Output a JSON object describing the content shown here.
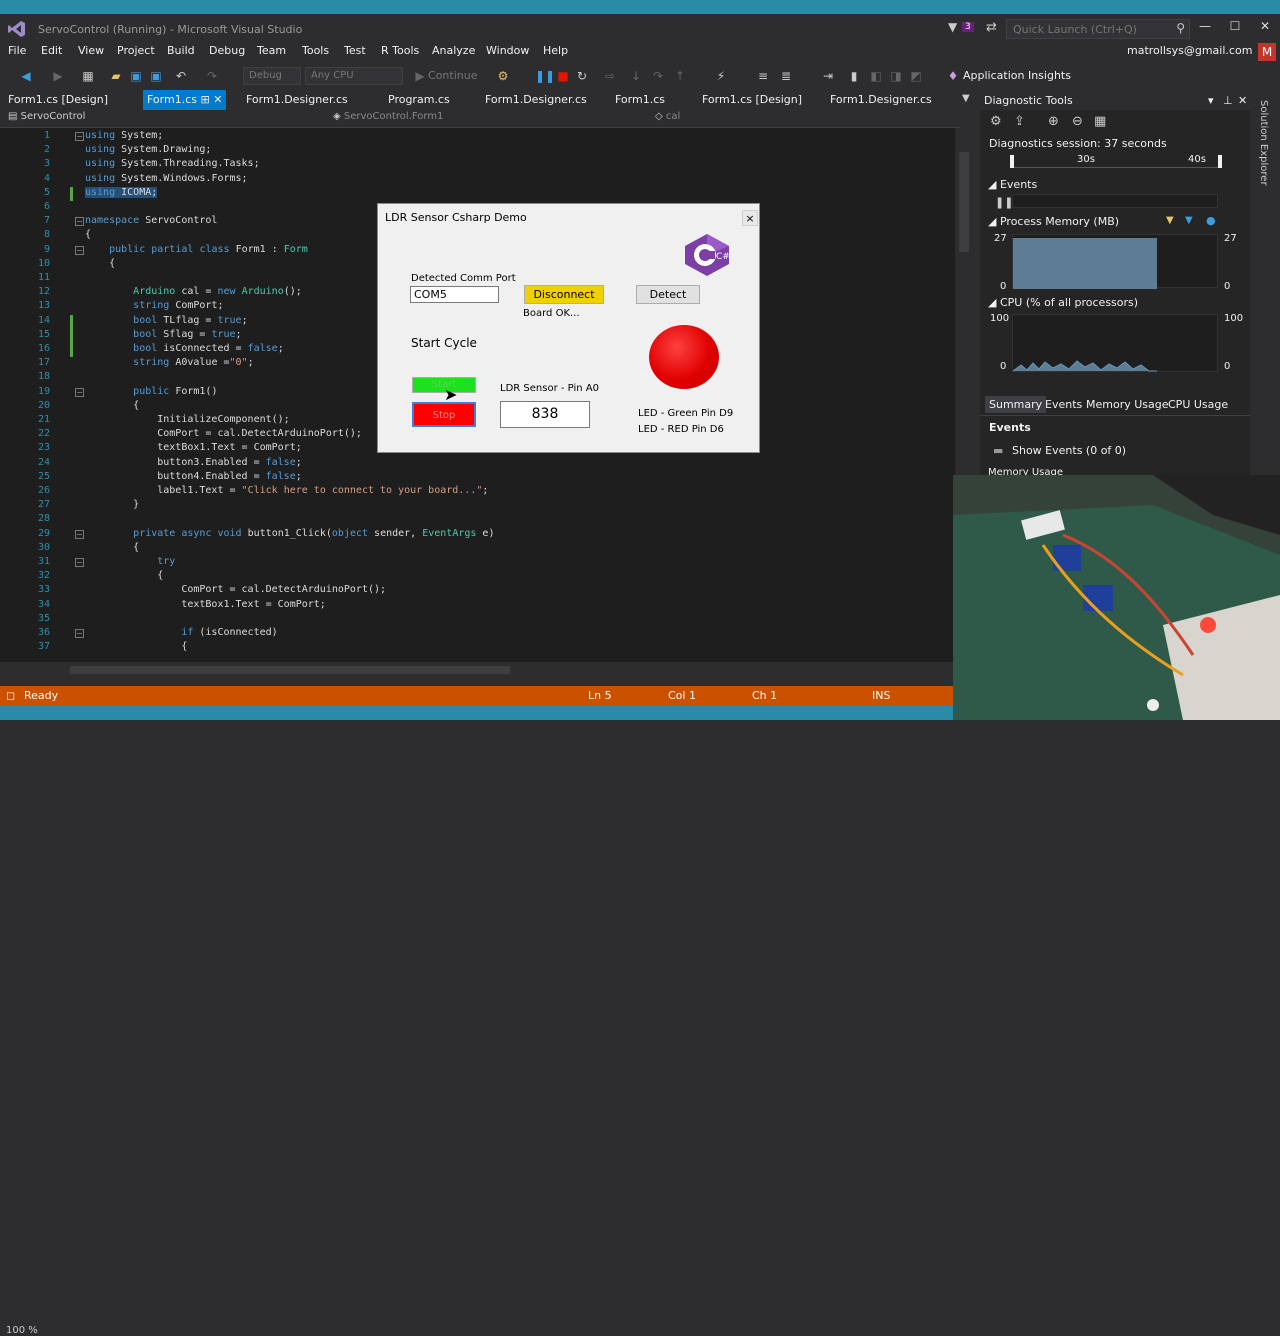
{
  "window": {
    "title": "ServoControl (Running) - Microsoft Visual Studio",
    "notifications": "3",
    "quick_launch_placeholder": "Quick Launch (Ctrl+Q)",
    "account": "matrollsys@gmail.com",
    "avatar_letter": "M"
  },
  "menu": [
    "File",
    "Edit",
    "View",
    "Project",
    "Build",
    "Debug",
    "Team",
    "Tools",
    "Test",
    "R Tools",
    "Analyze",
    "Window",
    "Help"
  ],
  "toolbar": {
    "config": "Debug",
    "platform": "Any CPU",
    "continue_label": "Continue",
    "insights_label": "Application Insights"
  },
  "tabs": [
    "Form1.cs [Design]",
    "Form1.cs",
    "Form1.Designer.cs",
    "Program.cs",
    "Form1.Designer.cs",
    "Form1.cs",
    "Form1.cs [Design]",
    "Form1.Designer.cs"
  ],
  "navbar": {
    "project": "ServoControl",
    "class": "ServoControl.Form1",
    "member": "cal"
  },
  "code_lines": [
    {
      "n": "1",
      "t": "using System;"
    },
    {
      "n": "2",
      "t": "using System.Drawing;"
    },
    {
      "n": "3",
      "t": "using System.Threading.Tasks;"
    },
    {
      "n": "4",
      "t": "using System.Windows.Forms;"
    },
    {
      "n": "5",
      "t": "using ICOMA;"
    },
    {
      "n": "6",
      "t": ""
    },
    {
      "n": "7",
      "t": "namespace ServoControl"
    },
    {
      "n": "8",
      "t": "{"
    },
    {
      "n": "9",
      "t": "    public partial class Form1 : Form"
    },
    {
      "n": "10",
      "t": "    {"
    },
    {
      "n": "11",
      "t": ""
    },
    {
      "n": "12",
      "t": "        Arduino cal = new Arduino();"
    },
    {
      "n": "13",
      "t": "        string ComPort;"
    },
    {
      "n": "14",
      "t": "        bool TLflag = true;"
    },
    {
      "n": "15",
      "t": "        bool Sflag = true;"
    },
    {
      "n": "16",
      "t": "        bool isConnected = false;"
    },
    {
      "n": "17",
      "t": "        string A0value =\"0\";"
    },
    {
      "n": "18",
      "t": ""
    },
    {
      "n": "19",
      "t": "        public Form1()"
    },
    {
      "n": "20",
      "t": "        {"
    },
    {
      "n": "21",
      "t": "            InitializeComponent();"
    },
    {
      "n": "22",
      "t": "            ComPort = cal.DetectArduinoPort();"
    },
    {
      "n": "23",
      "t": "            textBox1.Text = ComPort;"
    },
    {
      "n": "24",
      "t": "            button3.Enabled = false;"
    },
    {
      "n": "25",
      "t": "            button4.Enabled = false;"
    },
    {
      "n": "26",
      "t": "            label1.Text = \"Click here to connect to your board...\";"
    },
    {
      "n": "27",
      "t": "        }"
    },
    {
      "n": "28",
      "t": ""
    },
    {
      "n": "29",
      "t": "        private async void button1_Click(object sender, EventArgs e)"
    },
    {
      "n": "30",
      "t": "        {"
    },
    {
      "n": "31",
      "t": "            try"
    },
    {
      "n": "32",
      "t": "            {"
    },
    {
      "n": "33",
      "t": "                ComPort = cal.DetectArduinoPort();"
    },
    {
      "n": "34",
      "t": "                textBox1.Text = ComPort;"
    },
    {
      "n": "35",
      "t": ""
    },
    {
      "n": "36",
      "t": "                if (isConnected)"
    },
    {
      "n": "37",
      "t": "                {"
    }
  ],
  "zoom": "100 %",
  "status": {
    "state": "Ready",
    "line": "Ln 5",
    "col": "Col 1",
    "ch": "Ch 1",
    "mode": "INS"
  },
  "diagnostics": {
    "title": "Diagnostic Tools",
    "session": "Diagnostics session: 37 seconds",
    "timeline_30": "30s",
    "timeline_40": "40s",
    "events_label": "Events",
    "memory_label": "Process Memory (MB)",
    "mem_top": "27",
    "mem_bottom": "0",
    "cpu_label": "CPU (% of all processors)",
    "cpu_top": "100",
    "cpu_bottom": "0",
    "tabs": [
      "Summary",
      "Events",
      "Memory Usage",
      "CPU Usage"
    ],
    "events_section": "Events",
    "show_events": "Show Events (0 of 0)",
    "memory_usage_section": "Memory Usage"
  },
  "solution_explorer": "Solution Explorer",
  "dialog": {
    "title": "LDR Sensor Csharp Demo",
    "close": "×",
    "port_label": "Detected Comm Port",
    "port_value": "COM5",
    "disconnect": "Disconnect",
    "detect": "Detect",
    "board_status": "Board OK...",
    "start_cycle": "Start Cycle",
    "start": "Start",
    "stop": "Stop",
    "sensor_label": "LDR Sensor - Pin A0",
    "sensor_value": "838",
    "led_green": "LED - Green Pin D9",
    "led_red": "LED -  RED Pin D6",
    "logo_letter": "C#"
  }
}
